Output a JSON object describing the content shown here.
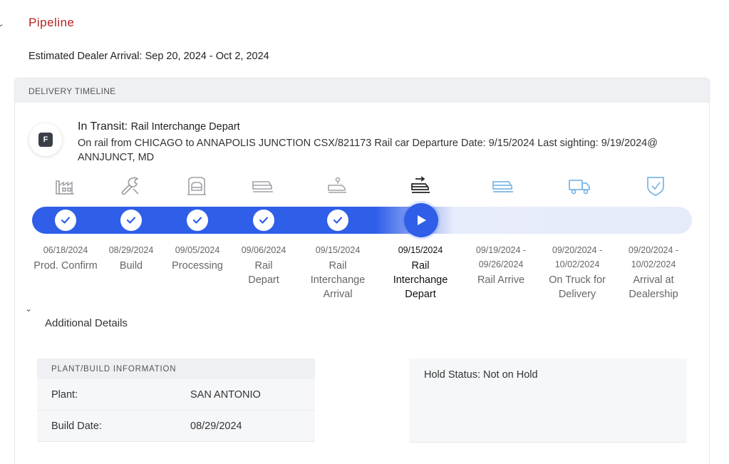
{
  "page": {
    "title": "Pipeline",
    "eta_label": "Estimated Dealer Arrival: Sep 20, 2024 - Oct 2, 2024"
  },
  "timeline": {
    "header": "DELIVERY TIMELINE",
    "status": {
      "badge": "F",
      "lead": "In Transit:",
      "detail": "Rail Interchange Depart",
      "description": "On rail from CHICAGO to ANNAPOLIS JUNCTION CSX/821173 Rail car Departure Date: 9/15/2024 Last sighting: 9/19/2024@ ANNJUNCT, MD"
    },
    "steps": [
      {
        "icon": "factory-icon",
        "date": "06/18/2024",
        "label": "Prod. Confirm",
        "state": "complete"
      },
      {
        "icon": "wrench-icon",
        "date": "08/29/2024",
        "label": "Build",
        "state": "complete"
      },
      {
        "icon": "assembly-icon",
        "date": "09/05/2024",
        "label": "Processing",
        "state": "complete"
      },
      {
        "icon": "rail-car-icon",
        "date": "09/06/2024",
        "label": "Rail Depart",
        "state": "complete"
      },
      {
        "icon": "rail-interchange-arrival-icon",
        "date": "09/15/2024",
        "label": "Rail Interchange Arrival",
        "state": "complete"
      },
      {
        "icon": "rail-interchange-depart-icon",
        "date": "09/15/2024",
        "label": "Rail Interchange Depart",
        "state": "current"
      },
      {
        "icon": "rail-arrive-icon",
        "date": "09/19/2024 - 09/26/2024",
        "label": "Rail Arrive",
        "state": "pending"
      },
      {
        "icon": "truck-icon",
        "date": "09/20/2024 - 10/02/2024",
        "label": "On Truck for Delivery",
        "state": "pending"
      },
      {
        "icon": "shield-check-icon",
        "date": "09/20/2024 - 10/02/2024",
        "label": "Arrival at Dealership",
        "state": "pending"
      }
    ],
    "colors": {
      "complete": "#2f5ee8",
      "pending": "#e6ebfa",
      "pending_icon": "#7cb8e6",
      "done_icon": "#9a9ca0"
    }
  },
  "additional": {
    "title": "Additional Details",
    "plant": {
      "header": "PLANT/BUILD INFORMATION",
      "rows": [
        {
          "key": "Plant:",
          "value": "SAN ANTONIO"
        },
        {
          "key": "Build Date:",
          "value": "08/29/2024"
        }
      ]
    },
    "hold_status": "Hold Status: Not on Hold"
  }
}
